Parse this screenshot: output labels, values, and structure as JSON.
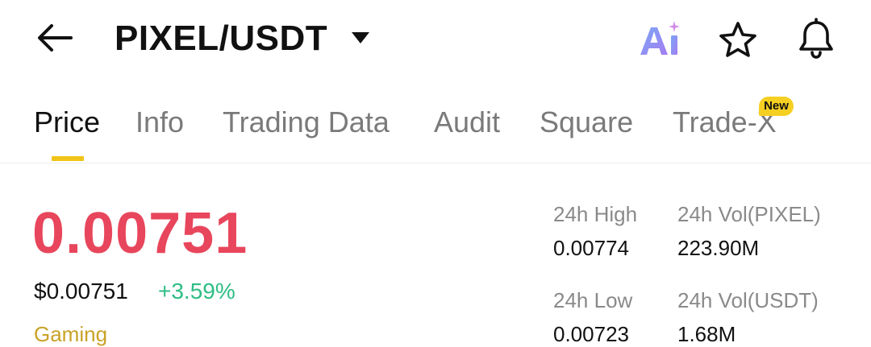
{
  "header": {
    "pair": "PIXEL/USDT",
    "back_icon": "arrow-left-icon",
    "dropdown_icon": "caret-down-icon",
    "ai_label": "Ai",
    "favorite_icon": "star-icon",
    "alert_icon": "bell-icon"
  },
  "tabs": [
    {
      "label": "Price",
      "active": true
    },
    {
      "label": "Info",
      "active": false
    },
    {
      "label": "Trading Data",
      "active": false
    },
    {
      "label": "Audit",
      "active": false
    },
    {
      "label": "Square",
      "active": false
    },
    {
      "label": "Trade-X",
      "active": false,
      "badge": "New"
    }
  ],
  "price": {
    "last": "0.00751",
    "usd": "$0.00751",
    "change": "+3.59%",
    "category": "Gaming"
  },
  "stats": {
    "high_label": "24h High",
    "high_value": "0.00774",
    "vol_base_label": "24h Vol(PIXEL)",
    "vol_base_value": "223.90M",
    "low_label": "24h Low",
    "low_value": "0.00723",
    "vol_quote_label": "24h Vol(USDT)",
    "vol_quote_value": "1.68M"
  },
  "colors": {
    "price_down_red": "#e8465c",
    "change_green": "#2ebd85",
    "accent_yellow": "#f0c419",
    "category_gold": "#c9a227"
  }
}
